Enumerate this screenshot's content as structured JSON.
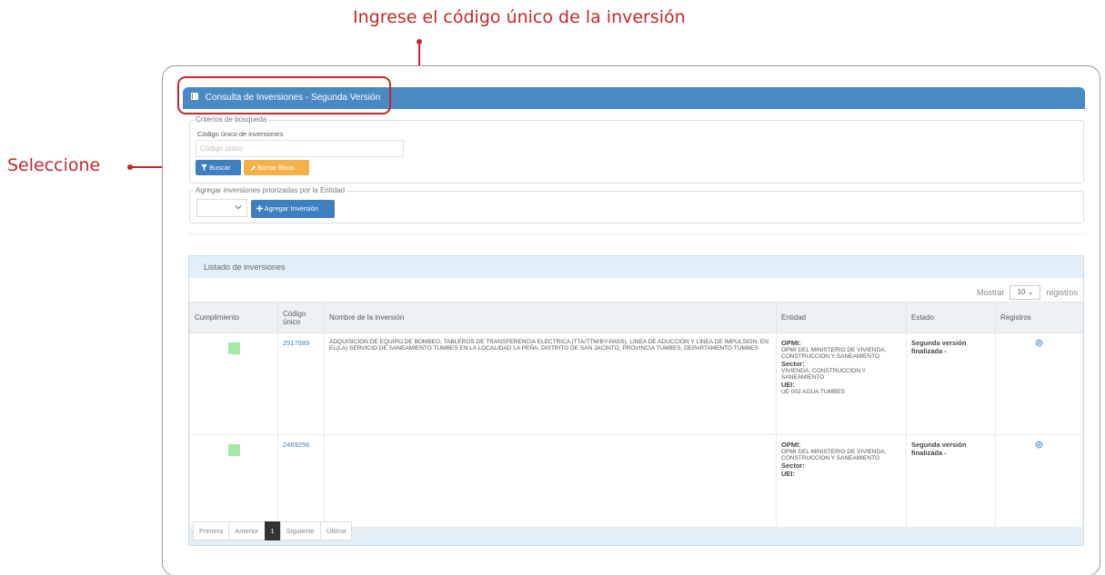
{
  "annotations": {
    "top": "Ingrese el código único de la inversión",
    "left": "Seleccione"
  },
  "panel": {
    "title": "Consulta de Inversiones - Segunda Versión"
  },
  "criteria": {
    "legend": "Criterios de búsqueda",
    "code_label": "Código único de inversiones",
    "code_placeholder": "Código único",
    "search_button": "Buscar",
    "clear_button": "Borrar filtros"
  },
  "prioritized": {
    "legend": "Agregar inversiones priorizadas por la Entidad",
    "add_button": "Agregar Inversión"
  },
  "list": {
    "title": "Listado de inversiones",
    "show_label": "Mostrar",
    "show_value": "10",
    "records_label": "registros",
    "columns": [
      "Cumplimiento",
      "Código único",
      "Nombre de la inversión",
      "Entidad",
      "Estado",
      "Registros"
    ],
    "rows": [
      {
        "code": "2517689",
        "name": "ADQUISICION DE EQUIPO DE BOMBEO, TABLEROS DE TRANSFERENCIA ELECTRICA (TTA/TTM/BY-PASS), LINEA DE ADUCCION Y LINEA DE IMPULSION; EN EL(LA) SERVICIO DE SANEAMIENTO TUMBES EN LA LOCALIDAD LA PEÑA, DISTRITO DE SAN JACINTO, PROVINCIA TUMBES, DEPARTAMENTO TUMBES",
        "opmi_label": "OPMI:",
        "opmi_value": "OPMI DEL MINISTERIO DE VIVIENDA, CONSTRUCCION Y SANEAMIENTO",
        "sector_label": "Sector:",
        "sector_value": "VIVIENDA, CONSTRUCCION Y SANEAMIENTO",
        "uei_label": "UEI:",
        "uei_value": "UE 002 AGUA TUMBES",
        "status": "Segunda versión finalizada -"
      },
      {
        "code": "2469256",
        "name": "",
        "opmi_label": "OPMI:",
        "opmi_value": "OPMI DEL MINISTERIO DE VIVIENDA, CONSTRUCCION Y SANEAMIENTO",
        "sector_label": "Sector:",
        "sector_value": "",
        "uei_label": "UEI:",
        "uei_value": "",
        "status": "Segunda versión finalizada -"
      }
    ]
  },
  "pager": {
    "first": "Primera",
    "prev": "Anterior",
    "current": "1",
    "next": "Siguiente",
    "last": "Última"
  },
  "colors": {
    "annotation": "#c62828",
    "header": "#4a8ac4",
    "primary_button": "#3d7fc1",
    "warning_button": "#f5b04a",
    "status_green": "#a5e8a5"
  },
  "icons": [
    "book-icon",
    "filter-icon",
    "eraser-icon",
    "plus-icon",
    "chevron-down-icon",
    "gear-icon"
  ]
}
